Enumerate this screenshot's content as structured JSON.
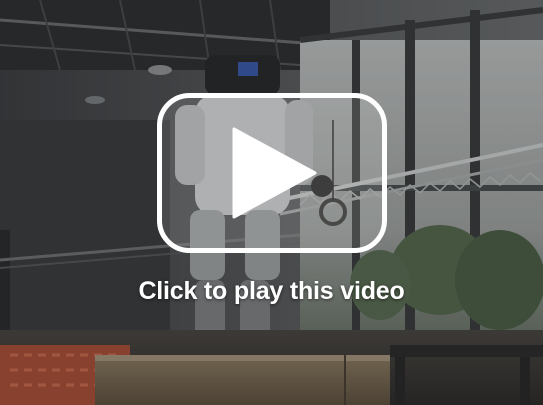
{
  "player": {
    "overlay_label": "Click to play this video",
    "play_icon": "play-icon",
    "colors": {
      "overlay_text": "#ffffff",
      "play_button_stroke": "#ffffff",
      "play_button_fill": "rgba(255,255,255,0.12)"
    }
  }
}
